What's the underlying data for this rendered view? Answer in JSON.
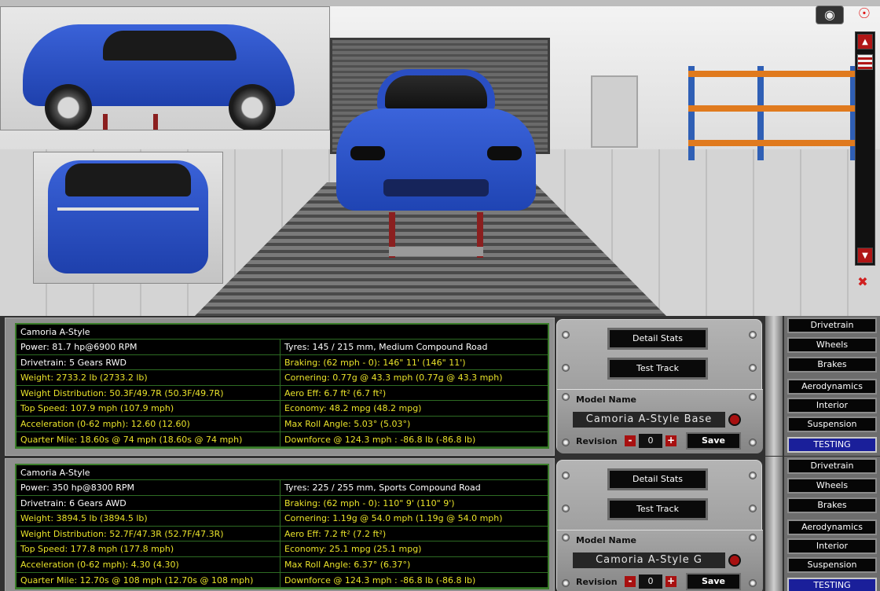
{
  "viewport": {
    "camera_icon": "camera-icon",
    "eye_icon": "eye-icon",
    "view_toggle_icon": "view-toggle-icon"
  },
  "cars": [
    {
      "title": "Camoria  A-Style",
      "stats_left": [
        {
          "text": "Power: 81.7 hp@6900 RPM",
          "color": "white"
        },
        {
          "text": "Drivetrain: 5 Gears RWD",
          "color": "white"
        },
        {
          "text": "Weight: 2733.2 lb (2733.2 lb)",
          "color": "yellow"
        },
        {
          "text": "Weight Distribution: 50.3F/49.7R (50.3F/49.7R)",
          "color": "yellow"
        },
        {
          "text": "Top Speed: 107.9 mph (107.9 mph)",
          "color": "yellow"
        },
        {
          "text": "Acceleration (0-62 mph): 12.60 (12.60)",
          "color": "yellow"
        },
        {
          "text": "Quarter Mile: 18.60s @ 74 mph (18.60s @ 74 mph)",
          "color": "yellow"
        }
      ],
      "stats_right": [
        {
          "text": "Tyres: 145 / 215 mm, Medium Compound Road",
          "color": "white"
        },
        {
          "text": "Braking: (62 mph - 0): 146\" 11' (146\" 11')",
          "color": "yellow"
        },
        {
          "text": "Cornering: 0.77g @ 43.3 mph (0.77g @ 43.3 mph)",
          "color": "yellow"
        },
        {
          "text": "Aero Eff: 6.7 ft² (6.7 ft²)",
          "color": "yellow"
        },
        {
          "text": "Economy: 48.2 mpg (48.2 mpg)",
          "color": "yellow"
        },
        {
          "text": "Max Roll Angle: 5.03° (5.03°)",
          "color": "yellow"
        },
        {
          "text": "Downforce @ 124.3 mph : -86.8 lb (-86.8 lb)",
          "color": "yellow"
        }
      ],
      "detail_stats_label": "Detail Stats",
      "test_track_label": "Test Track",
      "model_name_label": "Model Name",
      "model_name": "Camoria A-Style Base",
      "revision_label": "Revision",
      "revision_value": "0",
      "save_label": "Save",
      "tabs": [
        "Drivetrain",
        "Wheels",
        "Brakes",
        "Aerodynamics",
        "Interior",
        "Suspension",
        "TESTING"
      ],
      "active_tab": "TESTING"
    },
    {
      "title": "Camoria  A-Style",
      "stats_left": [
        {
          "text": "Power: 350 hp@8300 RPM",
          "color": "white"
        },
        {
          "text": "Drivetrain: 6 Gears AWD",
          "color": "white"
        },
        {
          "text": "Weight: 3894.5 lb (3894.5 lb)",
          "color": "yellow"
        },
        {
          "text": "Weight Distribution: 52.7F/47.3R (52.7F/47.3R)",
          "color": "yellow"
        },
        {
          "text": "Top Speed: 177.8 mph (177.8 mph)",
          "color": "yellow"
        },
        {
          "text": "Acceleration (0-62 mph): 4.30 (4.30)",
          "color": "yellow"
        },
        {
          "text": "Quarter Mile: 12.70s @ 108 mph (12.70s @ 108 mph)",
          "color": "yellow"
        }
      ],
      "stats_right": [
        {
          "text": "Tyres: 225 / 255 mm, Sports Compound Road",
          "color": "white"
        },
        {
          "text": "Braking: (62 mph - 0): 110\" 9' (110\" 9')",
          "color": "yellow"
        },
        {
          "text": "Cornering: 1.19g @ 54.0 mph (1.19g @ 54.0 mph)",
          "color": "yellow"
        },
        {
          "text": "Aero Eff: 7.2 ft² (7.2 ft²)",
          "color": "yellow"
        },
        {
          "text": "Economy: 25.1 mpg (25.1 mpg)",
          "color": "yellow"
        },
        {
          "text": "Max Roll Angle: 6.37° (6.37°)",
          "color": "yellow"
        },
        {
          "text": "Downforce @ 124.3 mph : -86.8 lb (-86.8 lb)",
          "color": "yellow"
        }
      ],
      "detail_stats_label": "Detail Stats",
      "test_track_label": "Test Track",
      "model_name_label": "Model Name",
      "model_name": "Camoria A-Style G",
      "revision_label": "Revision",
      "revision_value": "0",
      "save_label": "Save",
      "tabs": [
        "Drivetrain",
        "Wheels",
        "Brakes",
        "Aerodynamics",
        "Interior",
        "Suspension",
        "TESTING"
      ],
      "active_tab": "TESTING"
    }
  ],
  "colors": {
    "stat_white": "#ffffff",
    "stat_yellow": "#e8e22a",
    "grid_green": "#2d6b23",
    "car_blue": "#2a4fc4",
    "accent_red": "#b01616"
  }
}
